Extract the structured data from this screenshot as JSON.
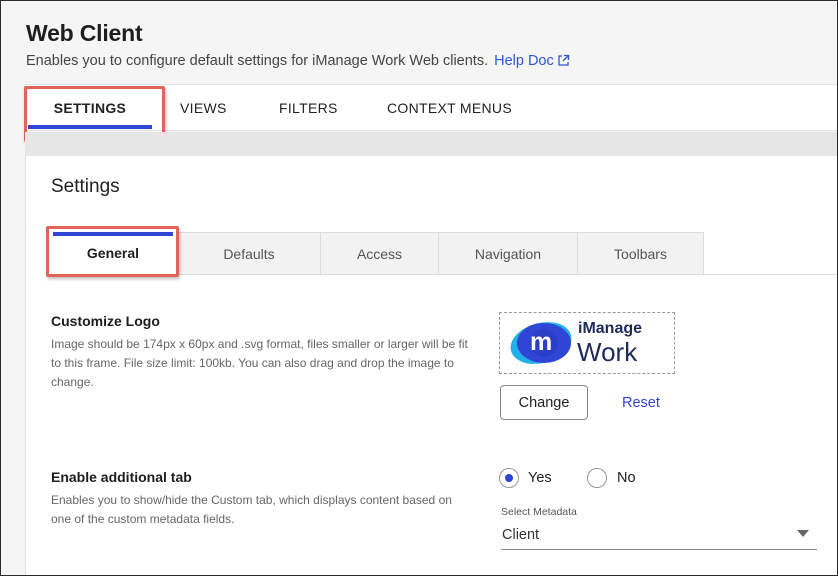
{
  "header": {
    "title": "Web Client",
    "subtitle": "Enables you to configure default settings for iManage Work Web clients.",
    "help_link": "Help Doc"
  },
  "top_tabs": [
    {
      "label": "SETTINGS",
      "active": true
    },
    {
      "label": "VIEWS",
      "active": false
    },
    {
      "label": "FILTERS",
      "active": false
    },
    {
      "label": "CONTEXT MENUS",
      "active": false
    }
  ],
  "settings": {
    "title": "Settings",
    "sub_tabs": [
      {
        "label": "General",
        "active": true
      },
      {
        "label": "Defaults",
        "active": false
      },
      {
        "label": "Access",
        "active": false
      },
      {
        "label": "Navigation",
        "active": false
      },
      {
        "label": "Toolbars",
        "active": false
      }
    ]
  },
  "customize_logo": {
    "title": "Customize Logo",
    "description": "Image should be 174px x 60px and .svg format, files smaller or larger will be fit to this frame. File size limit: 100kb. You can also drag and drop the image to change.",
    "logo_text_top": "iManage",
    "logo_text_bottom": "Work",
    "logo_mark": "m",
    "change_label": "Change",
    "reset_label": "Reset"
  },
  "additional_tab": {
    "title": "Enable additional tab",
    "description": "Enables you to show/hide the Custom tab, which displays content based on one of the custom metadata fields.",
    "yes_label": "Yes",
    "no_label": "No",
    "selected": "Yes",
    "select_label": "Select Metadata",
    "select_value": "Client"
  },
  "colors": {
    "accent": "#2f45d6",
    "highlight": "#e0645a",
    "logo_blue": "#2f45d6"
  },
  "icons": {
    "help_link_icon": "external-link-icon",
    "select_icon": "caret-down-icon"
  }
}
